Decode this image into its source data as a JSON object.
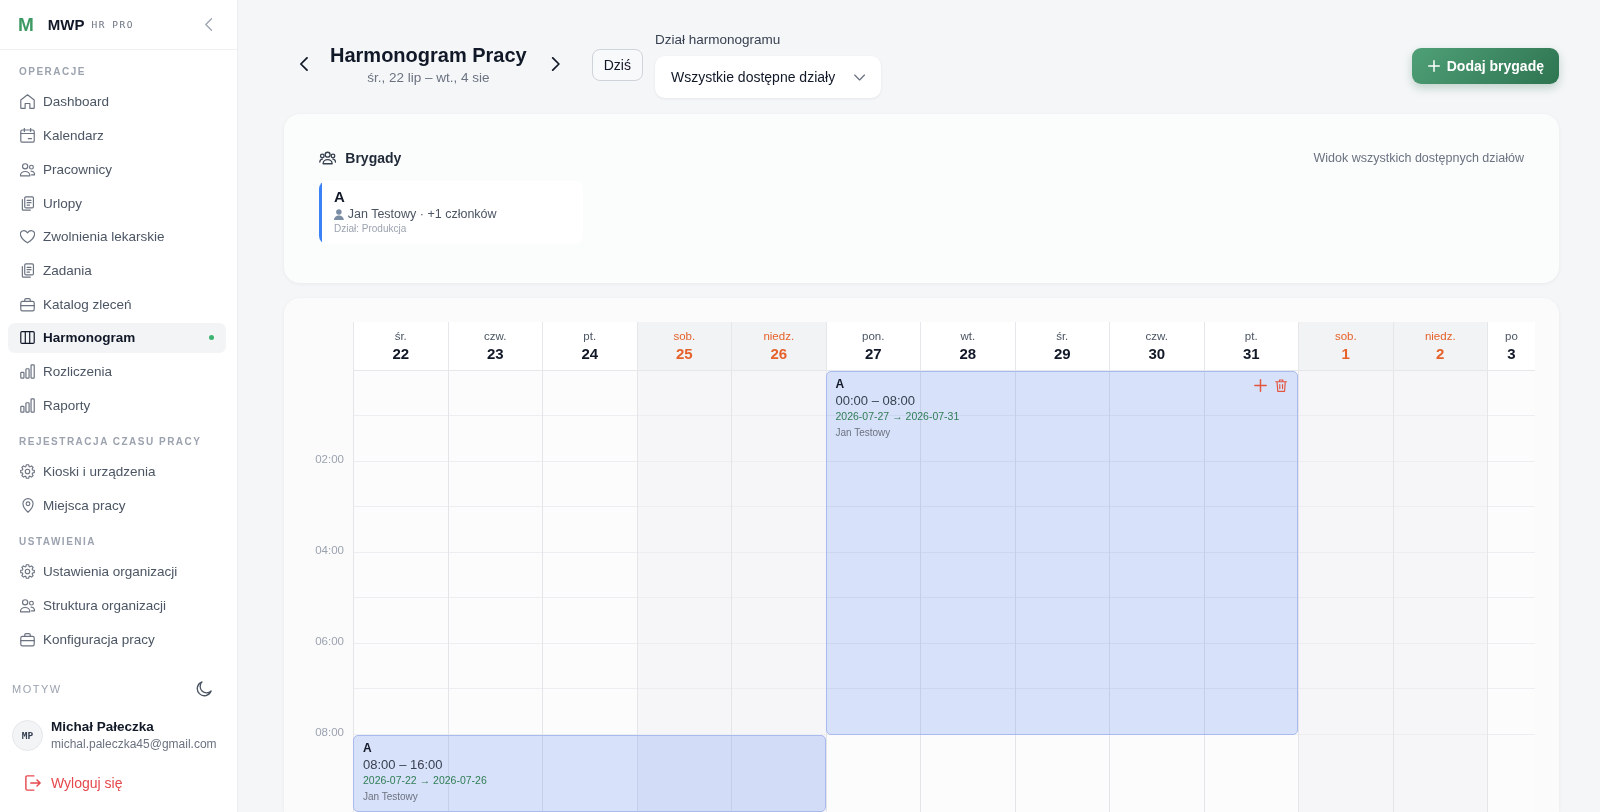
{
  "sidebar": {
    "brand": {
      "logo": "M",
      "name": "MWP",
      "tags": [
        "HR",
        "PRO"
      ]
    },
    "sections": [
      {
        "title": "OPERACJE",
        "items": [
          {
            "label": "Dashboard",
            "selected": false
          },
          {
            "label": "Kalendarz",
            "selected": false
          },
          {
            "label": "Pracownicy",
            "selected": false
          },
          {
            "label": "Urlopy",
            "selected": false
          },
          {
            "label": "Zwolnienia lekarskie",
            "selected": false
          },
          {
            "label": "Zadania",
            "selected": false
          },
          {
            "label": "Katalog zleceń",
            "selected": false
          },
          {
            "label": "Harmonogram",
            "selected": true
          },
          {
            "label": "Rozliczenia",
            "selected": false
          },
          {
            "label": "Raporty",
            "selected": false
          }
        ]
      },
      {
        "title": "REJESTRACJA CZASU PRACY",
        "items": [
          {
            "label": "Kioski i urządzenia",
            "selected": false
          },
          {
            "label": "Miejsca pracy",
            "selected": false
          }
        ]
      },
      {
        "title": "USTAWIENIA",
        "items": [
          {
            "label": "Ustawienia organizacji",
            "selected": false
          },
          {
            "label": "Struktura organizacji",
            "selected": false
          },
          {
            "label": "Konfiguracja pracy",
            "selected": false
          }
        ]
      }
    ],
    "theme": {
      "label": "MOTYW"
    },
    "user": {
      "initials": "MP",
      "name": "Michał Pałeczka",
      "email": "michal.paleczka45@gmail.com"
    },
    "logout": "Wyloguj się"
  },
  "header": {
    "title": "Harmonogram Pracy",
    "range": "śr., 22 lip – wt., 4 sie",
    "today_button": "Dziś",
    "department": {
      "label": "Dział harmonogramu",
      "value": "Wszystkie dostępne działy"
    },
    "add_button": "Dodaj brygadę"
  },
  "brigades": {
    "title": "Brygady",
    "note": "Widok wszystkich dostępnych działów",
    "items": [
      {
        "name": "A",
        "members": "Jan Testowy · +1 członków",
        "department": "Dział: Produkcja",
        "color": "#3b82f6"
      }
    ]
  },
  "schedule": {
    "days": [
      {
        "weekday": "śr.",
        "day": "22",
        "weekend": false
      },
      {
        "weekday": "czw.",
        "day": "23",
        "weekend": false
      },
      {
        "weekday": "pt.",
        "day": "24",
        "weekend": false
      },
      {
        "weekday": "sob.",
        "day": "25",
        "weekend": true
      },
      {
        "weekday": "niedz.",
        "day": "26",
        "weekend": true
      },
      {
        "weekday": "pon.",
        "day": "27",
        "weekend": false
      },
      {
        "weekday": "wt.",
        "day": "28",
        "weekend": false
      },
      {
        "weekday": "śr.",
        "day": "29",
        "weekend": false
      },
      {
        "weekday": "czw.",
        "day": "30",
        "weekend": false
      },
      {
        "weekday": "pt.",
        "day": "31",
        "weekend": false
      },
      {
        "weekday": "sob.",
        "day": "1",
        "weekend": true
      },
      {
        "weekday": "niedz.",
        "day": "2",
        "weekend": true
      },
      {
        "weekday": "po",
        "day": "3",
        "weekend": false
      }
    ],
    "times": [
      "02:00",
      "04:00",
      "06:00",
      "08:00"
    ],
    "shifts": [
      {
        "name": "A",
        "hours": "00:00 – 08:00",
        "dates": "2026-07-27 → 2026-07-31",
        "member": "Jan Testowy",
        "hovered": true
      },
      {
        "name": "A",
        "hours": "08:00 – 16:00",
        "dates": "2026-07-22 → 2026-07-26",
        "member": "Jan Testowy",
        "hovered": false
      }
    ]
  }
}
